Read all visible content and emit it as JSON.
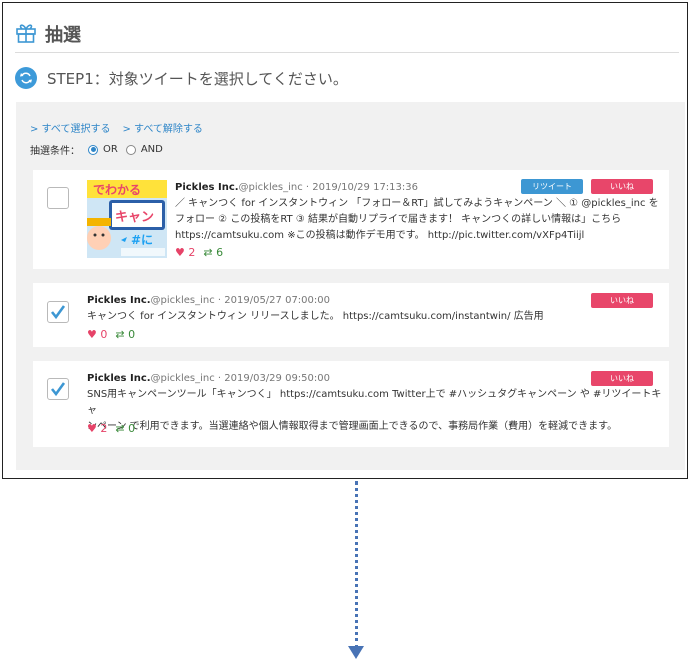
{
  "page": {
    "title": "抽選",
    "step": "STEP1：対象ツイートを選択してください。"
  },
  "controls": {
    "select_all": "> すべて選択する",
    "deselect_all": "> すべて解除する",
    "condition_label": "抽選条件：",
    "or_label": "OR",
    "and_label": "AND",
    "selected": "OR"
  },
  "tweets": [
    {
      "author": "Pickles Inc.",
      "handle": "@pickles_inc",
      "datetime": "2019/10/29 17:13:36",
      "line1": "／ キャンつく for インスタントウィン 「フォロー＆RT」試してみようキャンペーン ＼ ① @pickles_inc を",
      "line2": "フォロー ② この投稿をRT ③ 結果が自動リプライで届きます！ キャンつくの詳しい情報は」こちら",
      "line3": "https://camtsuku.com ※この投稿は動作デモ用です。 http://pic.twitter.com/vXFp4Tiijl",
      "likes": "2",
      "retweets": "6",
      "checked": false,
      "retweet_label": "リツイート",
      "like_label": "いいね"
    },
    {
      "author": "Pickles Inc.",
      "handle": "@pickles_inc",
      "datetime": "2019/05/27 07:00:00",
      "line1": "キャンつく for インスタントウィン リリースしました。 https://camtsuku.com/instantwin/ 広告用",
      "likes": "0",
      "retweets": "0",
      "checked": true,
      "like_label": "いいね"
    },
    {
      "author": "Pickles Inc.",
      "handle": "@pickles_inc",
      "datetime": "2019/03/29 09:50:00",
      "line1": "SNS用キャンペーンツール「キャンつく」 https://camtsuku.com Twitter上で #ハッシュタグキャンペーン や #リツイートキャ",
      "line2": "ンペーン で利用できます。当選連絡や個人情報取得まで管理画面上できるので、事務局作業（費用）を軽減できます。",
      "likes": "2",
      "retweets": "0",
      "checked": true,
      "like_label": "いいね"
    }
  ],
  "thumbnail": {
    "text_top": "でわかる",
    "text_mid": "キャン",
    "text_tag": "#に"
  },
  "colors": {
    "accent": "#3d97d3",
    "like": "#e8466a",
    "retweet": "#3a8a3a",
    "panel": "#f1f1f1"
  }
}
